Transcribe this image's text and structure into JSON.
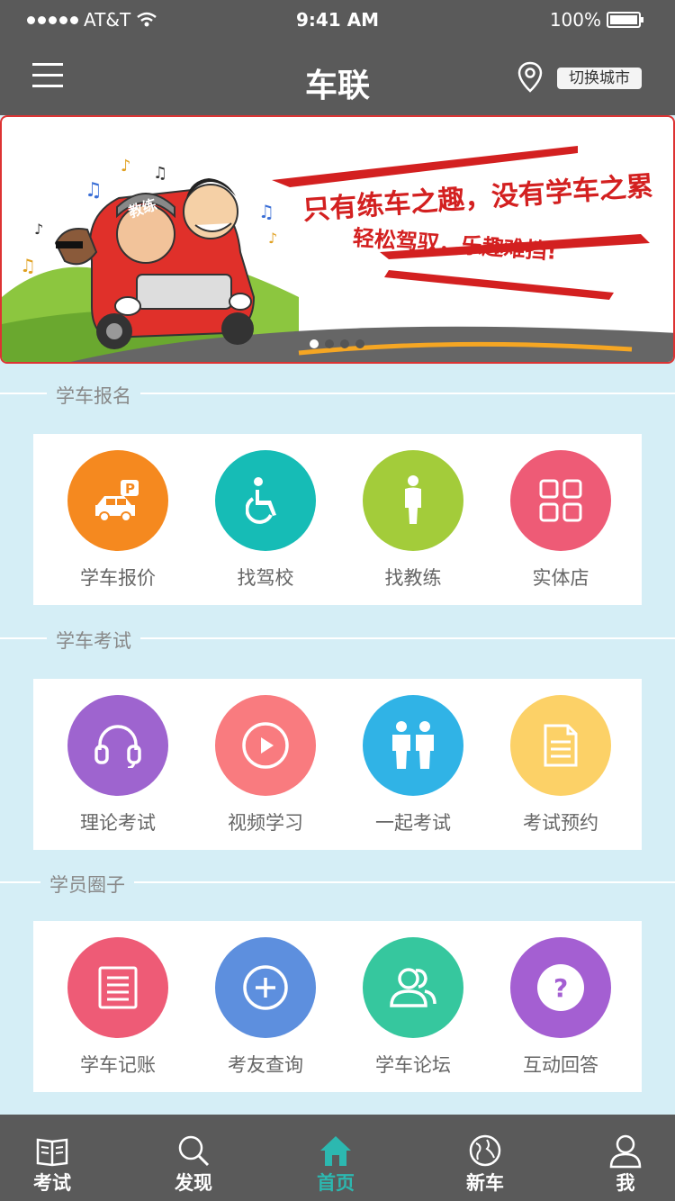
{
  "status_bar": {
    "carrier": "AT&T",
    "time": "9:41 AM",
    "battery": "100%"
  },
  "nav": {
    "title": "车联",
    "city_button": "切换城市"
  },
  "banner": {
    "slogan_line1": "只有练车之趣，没有学车之累",
    "slogan_line2": "轻松驾驭，乐趣难挡!",
    "car_sign": "教练",
    "pages": 4,
    "active_page": 1
  },
  "sections": [
    {
      "title": "学车报名",
      "items": [
        {
          "label": "学车报价",
          "color": "#f5891f",
          "icon": "parking-car-icon"
        },
        {
          "label": "找驾校",
          "color": "#16bcb6",
          "icon": "wheelchair-icon"
        },
        {
          "label": "找教练",
          "color": "#a3cc3a",
          "icon": "person-icon"
        },
        {
          "label": "实体店",
          "color": "#ee5b76",
          "icon": "grid-icon"
        }
      ]
    },
    {
      "title": "学车考试",
      "items": [
        {
          "label": "理论考试",
          "color": "#9e64cf",
          "icon": "headphones-icon"
        },
        {
          "label": "视频学习",
          "color": "#f97b7f",
          "icon": "play-icon"
        },
        {
          "label": "一起考试",
          "color": "#30b3e6",
          "icon": "two-people-icon"
        },
        {
          "label": "考试预约",
          "color": "#fcd167",
          "icon": "document-icon"
        }
      ]
    },
    {
      "title": "学员圈子",
      "items": [
        {
          "label": "学车记账",
          "color": "#ee5b76",
          "icon": "ledger-icon"
        },
        {
          "label": "考友查询",
          "color": "#5d8fde",
          "icon": "plus-circle-icon"
        },
        {
          "label": "学车论坛",
          "color": "#36c79e",
          "icon": "users-icon"
        },
        {
          "label": "互动回答",
          "color": "#a45fd2",
          "icon": "question-icon"
        }
      ]
    }
  ],
  "tabbar": {
    "active": "首页",
    "items": [
      {
        "label": "考试",
        "icon": "book-icon"
      },
      {
        "label": "发现",
        "icon": "search-icon"
      },
      {
        "label": "首页",
        "icon": "home-icon"
      },
      {
        "label": "新车",
        "icon": "globe-icon"
      },
      {
        "label": "我",
        "icon": "user-icon"
      }
    ]
  }
}
